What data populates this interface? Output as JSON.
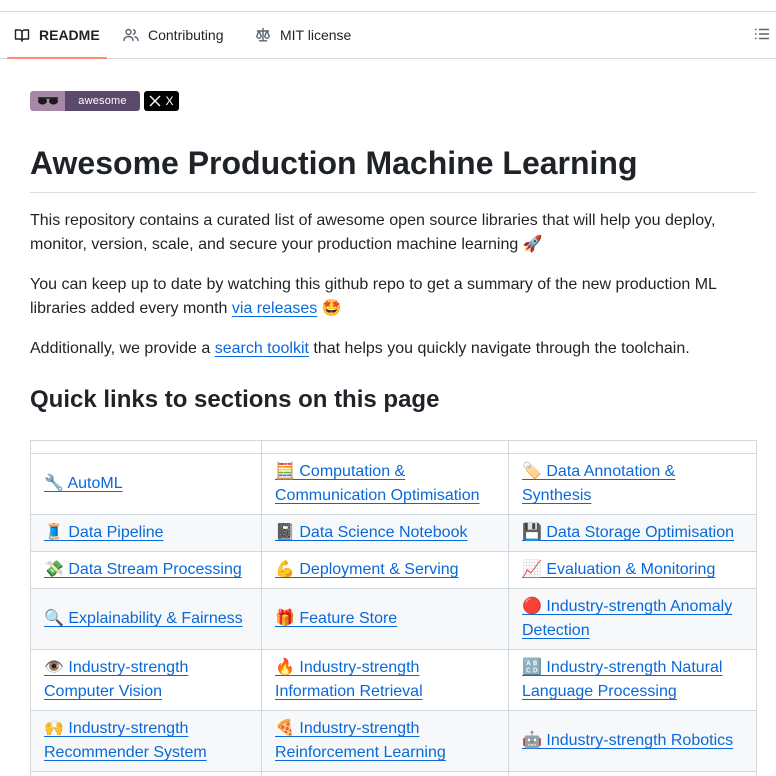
{
  "tabs": [
    {
      "label": "README",
      "icon": "book-icon",
      "active": true
    },
    {
      "label": "Contributing",
      "icon": "people-icon",
      "active": false
    },
    {
      "label": "MIT license",
      "icon": "law-icon",
      "active": false
    }
  ],
  "badges": {
    "awesome": "awesome",
    "x": "X"
  },
  "title": "Awesome Production Machine Learning",
  "intro": {
    "p1": "This repository contains a curated list of awesome open source libraries that will help you deploy, monitor, version, scale, and secure your production machine learning 🚀",
    "p2_a": "You can keep up to date by watching this github repo to get a summary of the new production ML libraries added every month ",
    "p2_link": "via releases",
    "p2_b": " 🤩",
    "p3_a": "Additionally, we provide a ",
    "p3_link": "search toolkit",
    "p3_b": " that helps you quickly navigate through the toolchain."
  },
  "quick_links_title": "Quick links to sections on this page",
  "quick_links": [
    [
      "🔧 AutoML",
      "🧮 Computation & Communication Optimisation",
      "🏷️ Data Annotation & Synthesis"
    ],
    [
      "🧵 Data Pipeline",
      "📓 Data Science Notebook",
      "💾 Data Storage Optimisation"
    ],
    [
      "💸 Data Stream Processing",
      "💪 Deployment & Serving",
      "📈 Evaluation & Monitoring"
    ],
    [
      "🔍 Explainability & Fairness",
      "🎁 Feature Store",
      "🔴 Industry-strength Anomaly Detection"
    ],
    [
      "👁️ Industry-strength Computer Vision",
      "🔥 Industry-strength Information Retrieval",
      "🔠 Industry-strength Natural Language Processing"
    ],
    [
      "🙌 Industry-strength Recommender System",
      "🍕 Industry-strength Reinforcement Learning",
      "🤖 Industry-strength Robotics"
    ]
  ]
}
